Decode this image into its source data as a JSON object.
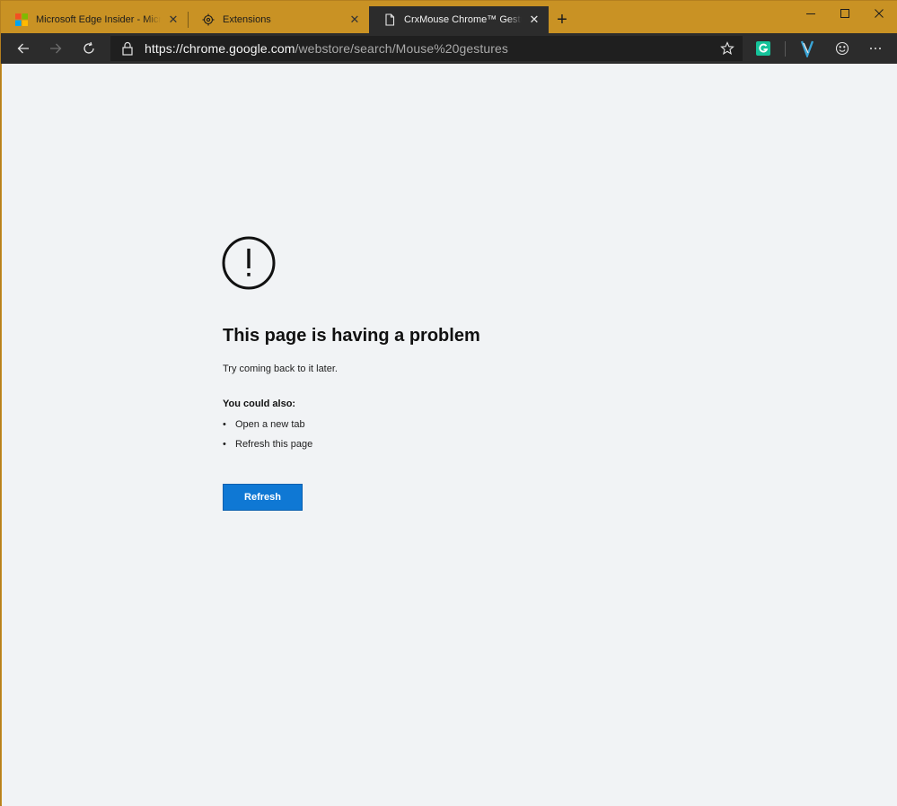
{
  "tabs": [
    {
      "title": "Microsoft Edge Insider - Microsoft",
      "icon": "microsoft-logo-icon"
    },
    {
      "title": "Extensions",
      "icon": "puzzle-icon"
    },
    {
      "title": "CrxMouse Chrome™ Gestures - Chrome",
      "icon": "page-icon",
      "active": true
    }
  ],
  "tab_close_glyph": "✕",
  "new_tab_glyph": "+",
  "address": {
    "host": "https://chrome.google.com",
    "path": "/webstore/search/Mouse%20gestures"
  },
  "error": {
    "title": "This page is having a problem",
    "subtitle": "Try coming back to it later.",
    "also_title": "You could also:",
    "options": [
      "Open a new tab",
      "Refresh this page"
    ],
    "refresh_label": "Refresh"
  },
  "colors": {
    "titlebar": "#c99224",
    "toolbar": "#2c2c2c",
    "accent": "#0f78d4",
    "page_bg": "#f1f3f5"
  }
}
